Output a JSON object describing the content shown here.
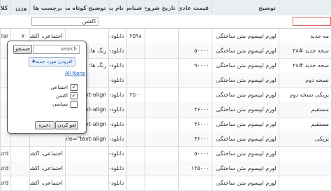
{
  "headers": {
    "col1": "کلا",
    "weight": "وزن",
    "tags": "برچسب ها",
    "short_desc": "توضیح کوتاه محصول",
    "name": "نام پس...",
    "id": "شناس...",
    "sale_start": "تاریخ شروع ف...",
    "price": "قیمت عادی",
    "desc": "توضیح",
    "extra": ""
  },
  "filter": {
    "tags_value": "اکشن"
  },
  "rows": [
    {
      "col1": "lar",
      "weight": "۷۰",
      "tags": "اجتماعی، اکشن، ...",
      "short_desc": "",
      "name": "دانلود-",
      "id": "۲۵۹۸",
      "sale": "",
      "price": "",
      "desc": "لورم ایپسوم متن ساختگی",
      "extra": "مه جدید"
    },
    {
      "col1": "",
      "weight": "",
      "tags": "",
      "short_desc": "رنگ ها: آبی",
      "name": "دانلود-",
      "id": "",
      "sale": "",
      "price": "۵۰۰۰۰",
      "desc": "لورم ایپسوم متن ساختگی",
      "extra": "سخه جدید #۳۸"
    },
    {
      "col1": "",
      "weight": "",
      "tags": "",
      "short_desc": "رنگ ها: قرمز",
      "name": "دانلود-",
      "id": "",
      "sale": "",
      "price": "۹۰۰۰۰",
      "desc": "لورم ایپسوم متن ساختگی",
      "extra": "سخه جدید #۳۸"
    },
    {
      "col1": "",
      "weight": "",
      "tags": "",
      "short_desc": "",
      "name": "دانلود-",
      "id": "",
      "sale": "",
      "price": "",
      "desc": "لورم ایپسوم متن ساختگی",
      "extra": "نسخه دوم"
    },
    {
      "col1": "",
      "weight": "",
      "tags": "",
      "short_desc": "style=\"text-align:",
      "name": "دانلود-",
      "id": "۲۵۰۰",
      "sale": "",
      "price": "",
      "desc": "لورم ایپسوم متن ساختگی",
      "extra": "یزیکی نسخه دوم"
    },
    {
      "col1": "",
      "weight": "",
      "tags": "",
      "short_desc": "style=\"text-align:",
      "name": "دانلود-",
      "id": "",
      "sale": "",
      "price": "۳۶۰۰۰",
      "desc": "لورم ایپسوم متن ساختگی",
      "extra": "مستقیم"
    },
    {
      "col1": "",
      "weight": "",
      "tags": "",
      "short_desc": "style=\"text-align:",
      "name": "دانلود-",
      "id": "",
      "sale": "",
      "price": "۳۶۰۰۰",
      "desc": "لورم ایپسوم متن ساختگی",
      "extra": "مستقیم"
    },
    {
      "col1": "",
      "weight": "",
      "tags": "",
      "short_desc": "p style=\"text-align:",
      "name": "دانلود-",
      "id": "",
      "sale": "",
      "price": "۳۶۰۰۰",
      "desc": "لورم ایپسوم متن ساختگی",
      "extra": "یزیکی"
    },
    {
      "col1": "urd",
      "weight": "",
      "tags": "اجتماعی، اکشن، ...",
      "short_desc": "",
      "name": "دانلود-",
      "id": "",
      "sale": "",
      "price": "۵۰۰۰۰",
      "desc": "لورم ایپسوم متن ساختگی",
      "extra": ""
    },
    {
      "col1": "urd",
      "weight": "",
      "tags": "اجتماعی، اکشن، ...",
      "short_desc": "",
      "name": "دانلود-",
      "id": "",
      "sale": "",
      "price": "۱۲۵۰۰۰",
      "desc": "لورم ایپسوم متن ساختگی",
      "extra": ""
    },
    {
      "col1": "urd",
      "weight": "",
      "tags": "اجتماعی، اکشن، ...",
      "short_desc": "",
      "name": "دانلود-",
      "id": "",
      "sale": "",
      "price": "",
      "desc": "لورم ایپسوم متن ساختگی",
      "extra": ""
    }
  ],
  "popup": {
    "search_placeholder": "search",
    "search_button": "جستجو",
    "add_button": "افزودن مورد جدید",
    "all_link": "All",
    "none_link": "None",
    "options": [
      {
        "label": "اجتماعی",
        "checked": "✓"
      },
      {
        "label": "اکشن",
        "checked": "✓"
      },
      {
        "label": "سیاسی",
        "checked": ""
      }
    ],
    "ok_button": "ذخیره",
    "cancel_button": "لغو کردن"
  }
}
